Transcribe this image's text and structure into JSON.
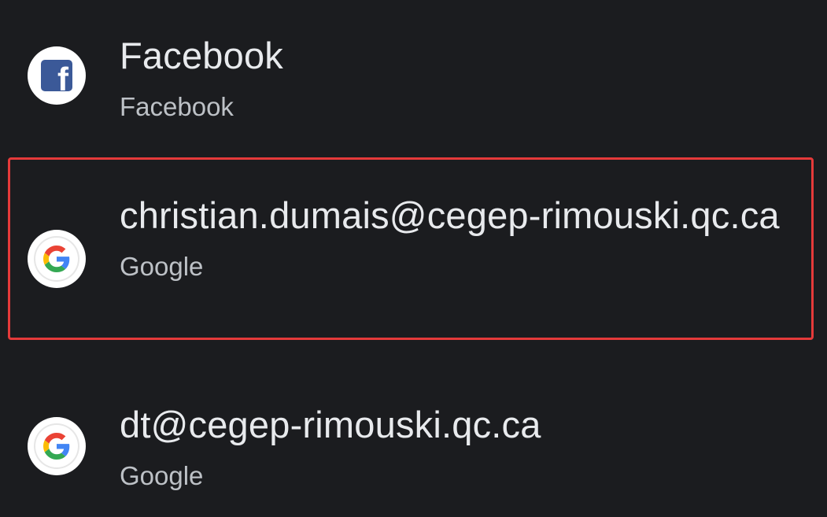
{
  "accounts": [
    {
      "id": "facebook",
      "primary": "Facebook",
      "secondary": "Facebook",
      "icon": "facebook-icon",
      "highlighted": false
    },
    {
      "id": "google-1",
      "primary": "christian.dumais@cegep-rimouski.qc.ca",
      "secondary": "Google",
      "icon": "google-icon",
      "highlighted": true
    },
    {
      "id": "google-2",
      "primary": "dt@cegep-rimouski.qc.ca",
      "secondary": "Google",
      "icon": "google-icon",
      "highlighted": false
    }
  ],
  "colors": {
    "background": "#1b1c1f",
    "primary_text": "#e8eaed",
    "secondary_text": "#bdc1c6",
    "highlight": "#e53a3a",
    "facebook_blue": "#3b5998"
  }
}
